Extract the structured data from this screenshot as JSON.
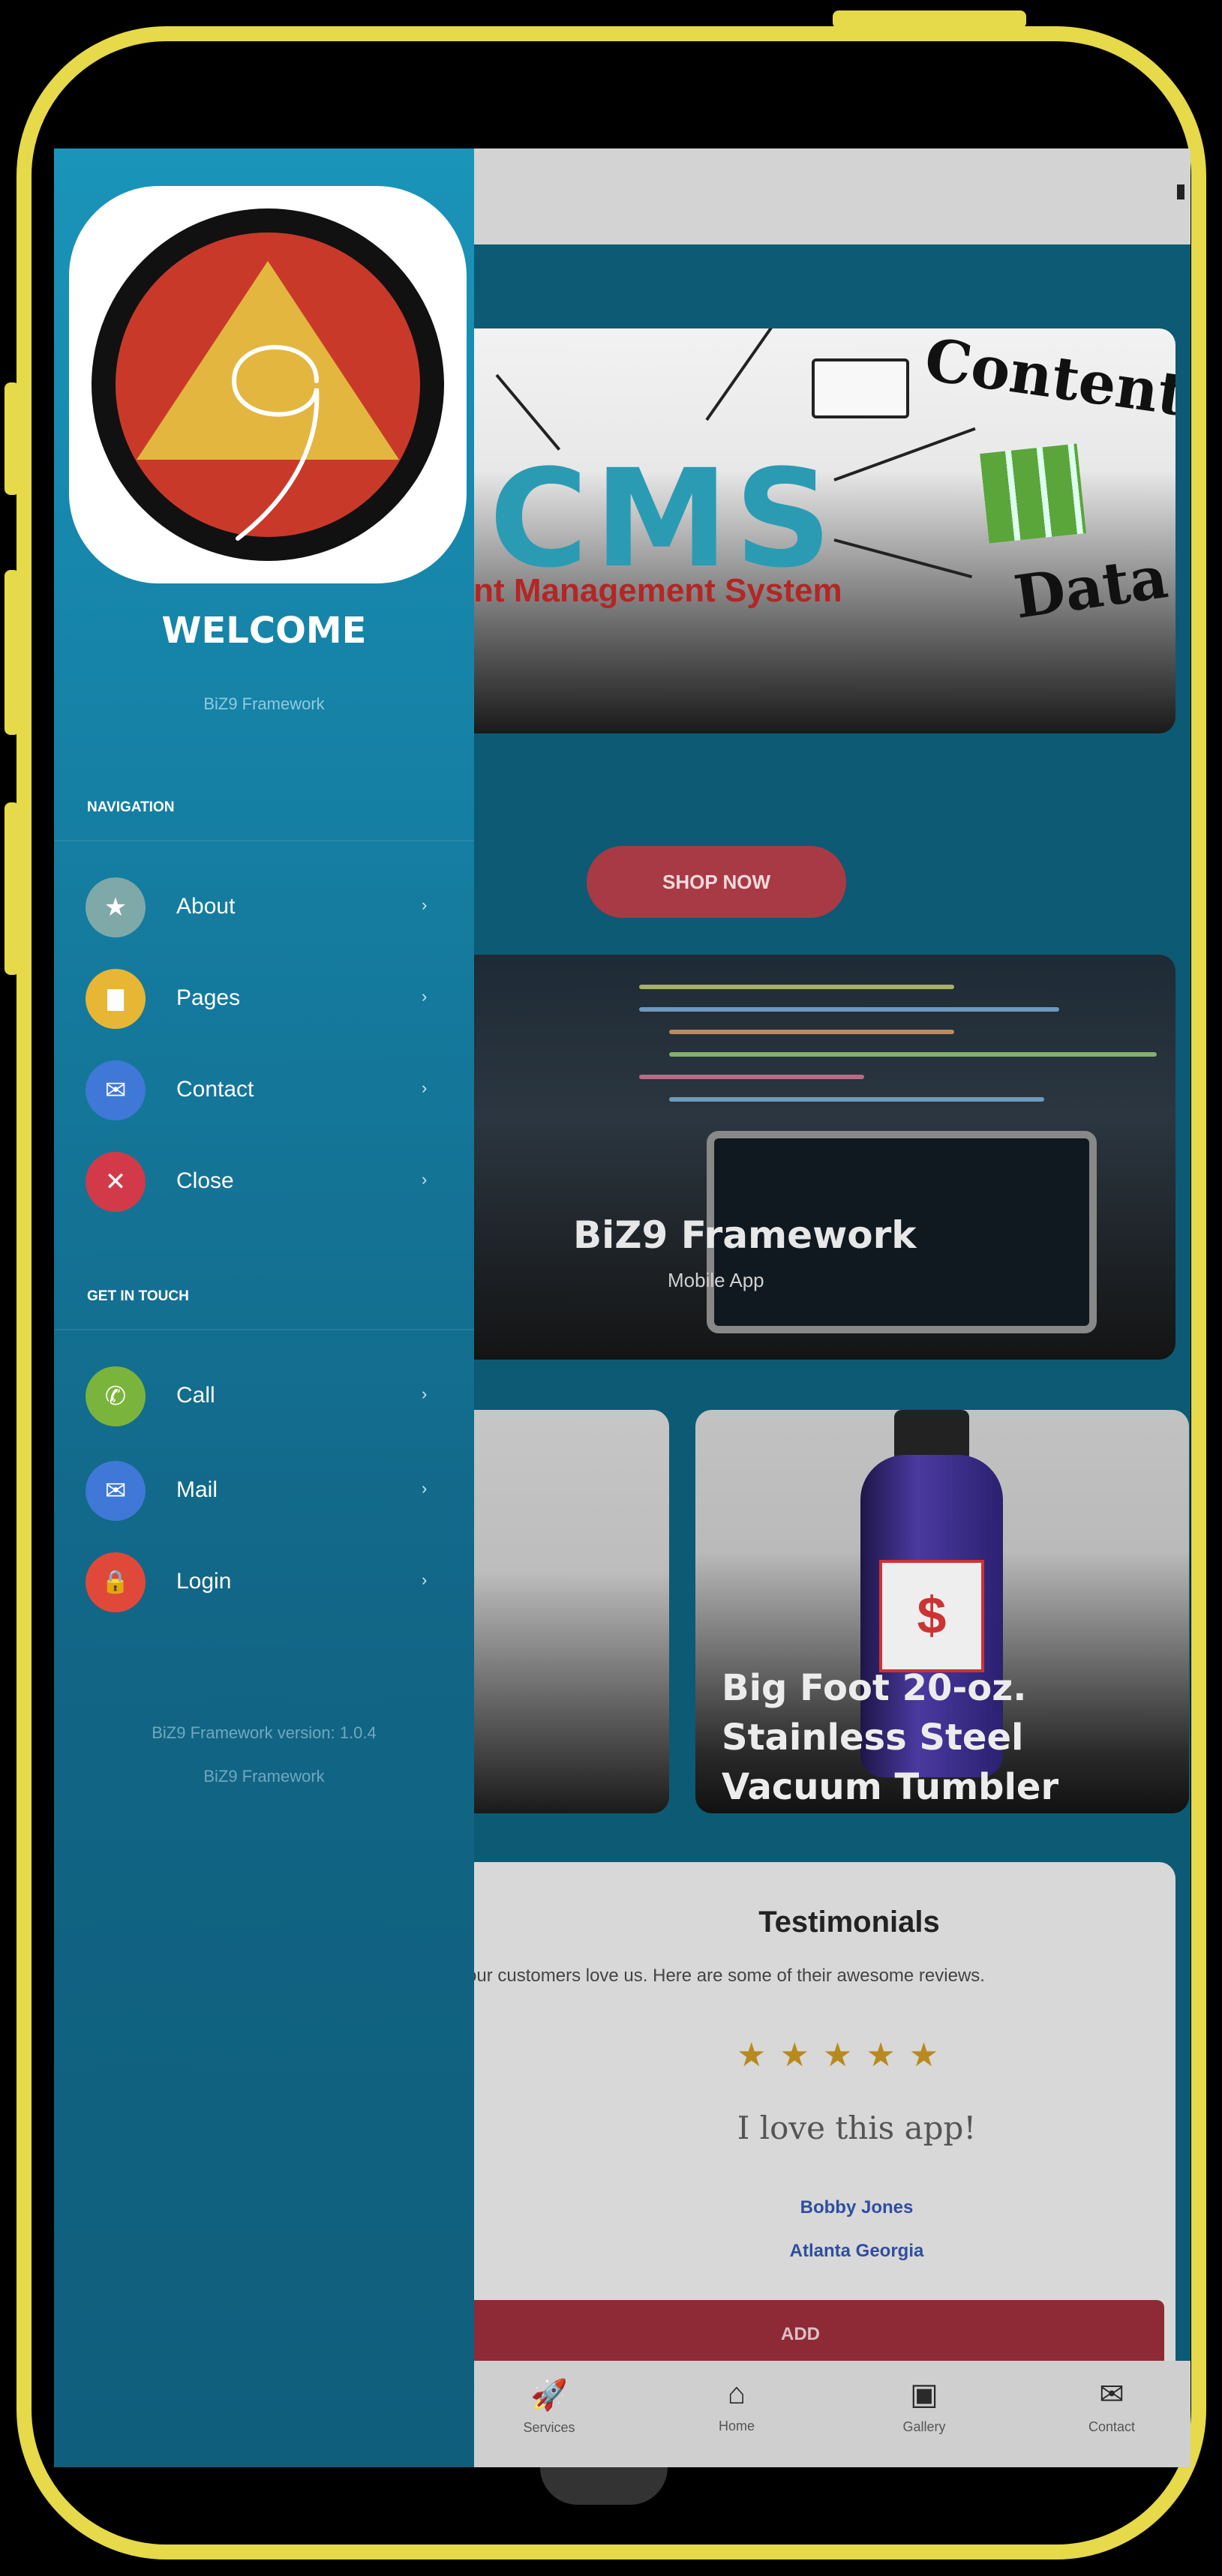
{
  "drawer": {
    "welcome": "WELCOME",
    "subtitle": "BiZ9 Framework",
    "navigation_heading": "NAVIGATION",
    "nav_items": [
      {
        "label": "About",
        "icon": "star-icon",
        "color": "#7fa9a8",
        "glyph": "★"
      },
      {
        "label": "Pages",
        "icon": "page-icon",
        "color": "#e8b635",
        "glyph": "▇"
      },
      {
        "label": "Contact",
        "icon": "envelope-icon",
        "color": "#3f78d6",
        "glyph": "✉"
      },
      {
        "label": "Close",
        "icon": "close-icon",
        "color": "#d23a4a",
        "glyph": "✕"
      }
    ],
    "get_in_touch_heading": "GET IN TOUCH",
    "touch_items": [
      {
        "label": "Call",
        "icon": "phone-icon",
        "color": "#7bb43c",
        "glyph": "✆"
      },
      {
        "label": "Mail",
        "icon": "envelope-icon",
        "color": "#3f78d6",
        "glyph": "✉"
      },
      {
        "label": "Login",
        "icon": "lock-icon",
        "color": "#e0493a",
        "glyph": "🔒"
      }
    ],
    "chevron": "›",
    "version": "BiZ9 Framework version: 1.0.4",
    "footer_name": "BiZ9 Framework"
  },
  "banner": {
    "cms": "CMS",
    "cms_subtitle": "tent Management System",
    "word_content": "Content",
    "word_data": "Data",
    "shop_now": "SHOP NOW"
  },
  "feature": {
    "title": "BiZ9 Framework",
    "subtitle": "Mobile App"
  },
  "product": {
    "title": "Big Foot 20-oz. Stainless Steel Vacuum Tumbler",
    "label_glyph": "$"
  },
  "testimonials": {
    "title": "Testimonials",
    "subtitle": "d our customers love us. Here are some of their awesome reviews.",
    "stars": "★★★★★",
    "quote": "I love this app!",
    "name": "Bobby Jones",
    "location": "Atlanta Georgia",
    "add_label": "ADD"
  },
  "bottom_nav": [
    {
      "label": "Services",
      "icon": "rocket-icon",
      "glyph": "🚀"
    },
    {
      "label": "Home",
      "icon": "home-icon",
      "glyph": "⌂"
    },
    {
      "label": "Gallery",
      "icon": "image-icon",
      "glyph": "▣"
    },
    {
      "label": "Contact",
      "icon": "envelope-icon",
      "glyph": "✉"
    }
  ],
  "colors": {
    "frame": "#e6d94a",
    "drawer_top": "#1a94b9",
    "drawer_bottom": "#0f5e7c",
    "accent_red": "#a83a45"
  }
}
